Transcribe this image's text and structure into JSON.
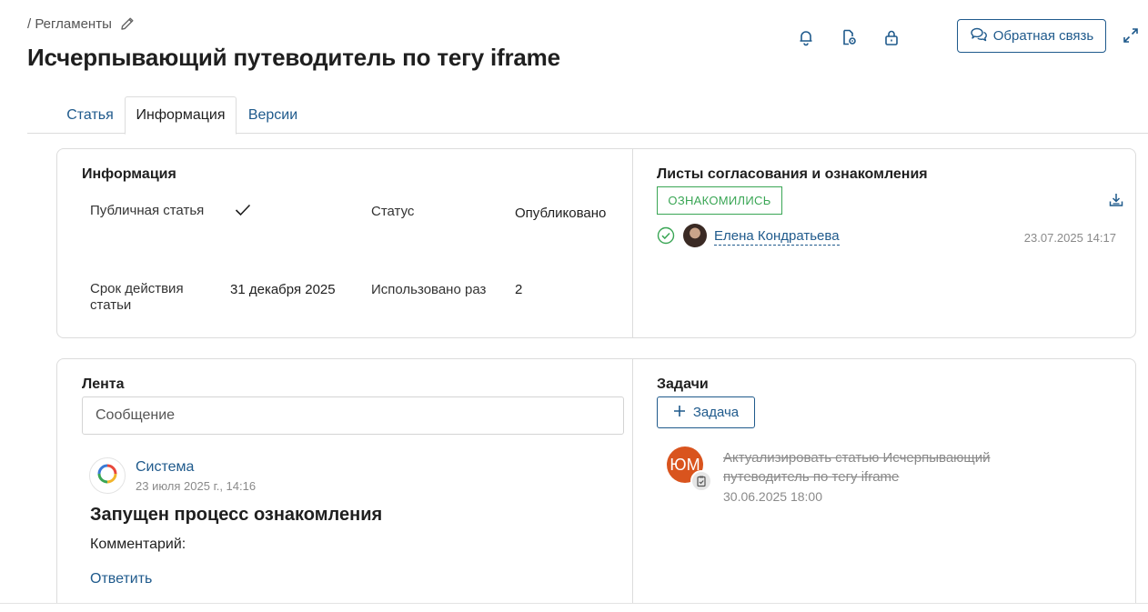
{
  "header": {
    "breadcrumb": "/ Регламенты",
    "title": "Исчерпывающий путеводитель по тегу iframe",
    "feedback_label": "Обратная связь"
  },
  "tabs": [
    {
      "label": "Статья"
    },
    {
      "label": "Информация",
      "active": true
    },
    {
      "label": "Версии"
    }
  ],
  "info": {
    "title": "Информация",
    "public_label": "Публичная статья",
    "status_label": "Статус",
    "status_value": "Опубликовано",
    "validity_label": "Срок действия статьи",
    "validity_value": "31 декабря 2025",
    "used_label": "Использовано раз",
    "used_value": "2"
  },
  "approval": {
    "title": "Листы согласования и ознакомления",
    "badge": "ОЗНАКОМИЛИСЬ",
    "person": "Елена Кондратьева",
    "date": "23.07.2025 14:17"
  },
  "feed": {
    "title": "Лента",
    "message_placeholder": "Сообщение",
    "author": "Система",
    "date": "23 июля 2025 г., 14:16",
    "post_title": "Запущен процесс ознакомления",
    "comment_label": "Комментарий:",
    "reply": "Ответить"
  },
  "tasks": {
    "title": "Задачи",
    "add_label": "Задача",
    "item_initials": "ЮМ",
    "item_text": "Актуализировать статью Исчерпывающий путеводитель по тегу iframe",
    "item_date": "30.06.2025 18:00"
  },
  "colors": {
    "link": "#1f5a8c",
    "success": "#3aa655",
    "task_avatar": "#d9541e"
  },
  "icons": [
    "pencil-icon",
    "bell-icon",
    "document-settings-icon",
    "lock-icon",
    "chat-icon",
    "expand-icon",
    "download-icon",
    "check-circle-icon",
    "check-icon",
    "plus-icon",
    "clipboard-icon",
    "system-logo-icon"
  ]
}
